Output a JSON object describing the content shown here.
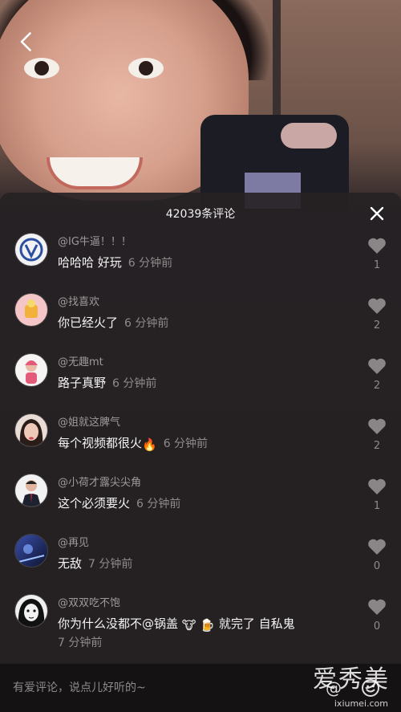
{
  "sheet": {
    "title": "42039条评论"
  },
  "comments": [
    {
      "user": "@IG牛逼！！！",
      "text": "哈哈哈 好玩",
      "time": "6 分钟前",
      "likes": "1"
    },
    {
      "user": "@找喜欢",
      "text": "你已经火了",
      "time": "6 分钟前",
      "likes": "2"
    },
    {
      "user": "@无趣mt",
      "text": "路子真野",
      "time": "6 分钟前",
      "likes": "2"
    },
    {
      "user": "@姐就这脾气",
      "text": "每个视频都很火",
      "emoji": "🔥",
      "time": "6 分钟前",
      "likes": "2"
    },
    {
      "user": "@小荷才露尖尖角",
      "text": "这个必须要火",
      "time": "6 分钟前",
      "likes": "1"
    },
    {
      "user": "@再见",
      "text": "无敌",
      "time": "7 分钟前",
      "likes": "0"
    },
    {
      "user": "@双双吃不饱",
      "text": "你为什么没都不@锅盖",
      "emoji1": "🐮",
      "emoji2": "🍺",
      "text_end": "就完了 自私鬼",
      "time": "7 分钟前",
      "likes": "0"
    }
  ],
  "input": {
    "placeholder": "有爱评论，说点儿好听的~"
  },
  "icons": {
    "back": "back-arrow-icon",
    "close": "close-icon",
    "like": "heart-icon",
    "mention": "at-icon",
    "emoji": "smile-icon"
  },
  "watermark": {
    "main": "爱秀美",
    "sub": "ixiumei.com"
  }
}
